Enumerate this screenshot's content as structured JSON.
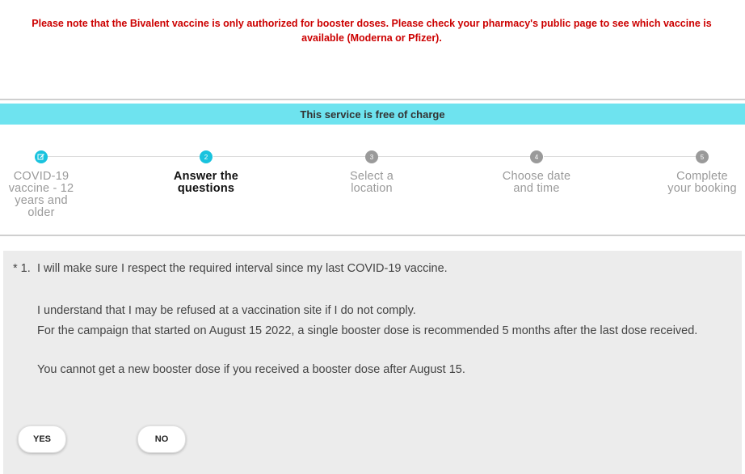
{
  "notice": {
    "text": "Please note that the Bivalent vaccine is only authorized for booster doses. Please check your pharmacy's public page to see which vaccine is available (Moderna or Pfizer)."
  },
  "banner": {
    "text": "This service is free of charge"
  },
  "stepper": {
    "current_step": 2,
    "steps": [
      {
        "number": "✎",
        "label_lines": [
          "COVID-19",
          "vaccine - 12",
          "years and",
          "older"
        ]
      },
      {
        "number": "2",
        "label_lines": [
          "Answer the",
          "questions"
        ]
      },
      {
        "number": "3",
        "label_lines": [
          "Select a",
          "location"
        ]
      },
      {
        "number": "4",
        "label_lines": [
          "Choose date",
          "and time"
        ]
      },
      {
        "number": "5",
        "label_lines": [
          "Complete",
          "your booking"
        ]
      }
    ]
  },
  "question": {
    "number": "* 1.",
    "text": "I will make sure I respect the required interval since my last COVID-19 vaccine.",
    "detail_1": "I understand that I may be refused at a vaccination site if I do not comply.",
    "detail_2": "For the campaign that started on August 15 2022, a single booster dose is recommended 5 months after the last dose received.",
    "detail_3": "You cannot get a new booster dose if you received a booster dose after August 15."
  },
  "answers": {
    "yes_label": "YES",
    "no_label": "NO"
  }
}
